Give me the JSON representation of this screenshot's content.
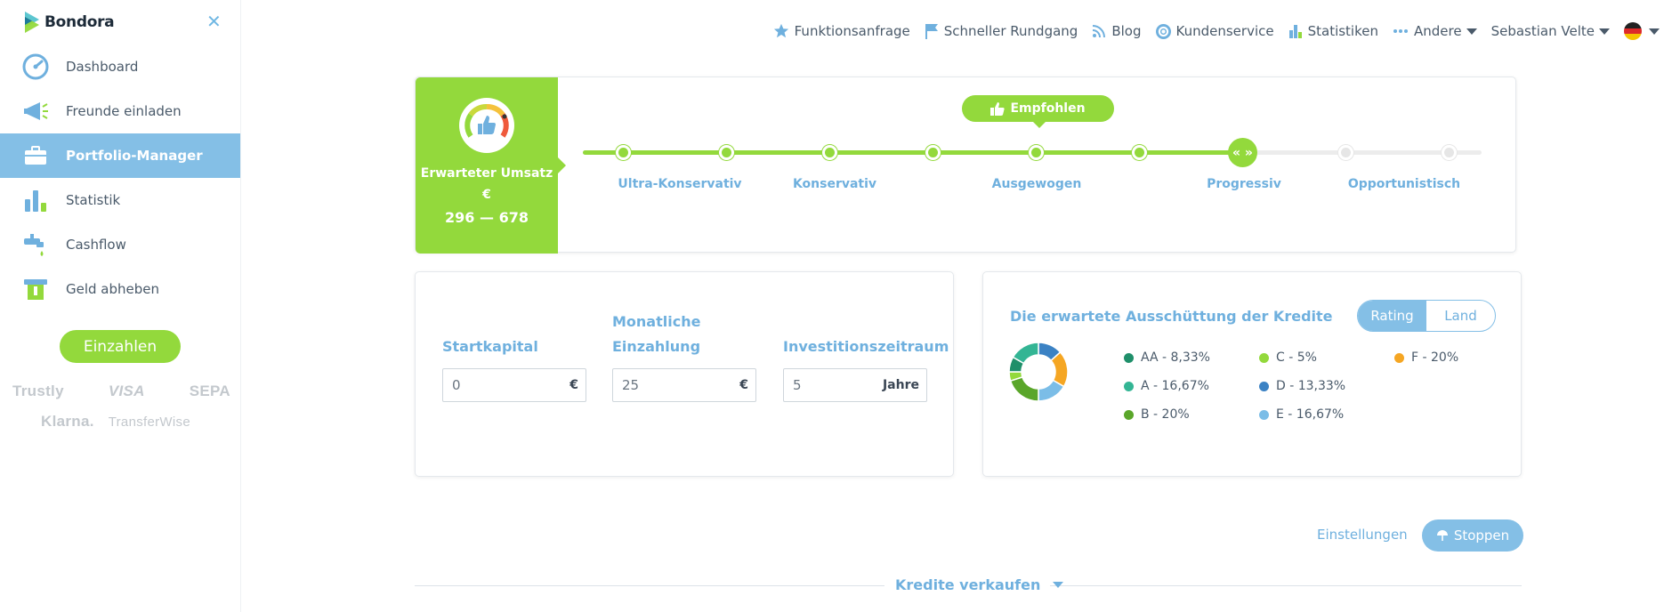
{
  "brand": {
    "name": "Bondora",
    "green": "#93d93c",
    "blue": "#84bfe6",
    "link": "#6fb0de"
  },
  "sidebar": {
    "close_icon": "close-icon",
    "items": [
      {
        "label": "Dashboard",
        "icon": "speedometer-icon",
        "active": false
      },
      {
        "label": "Freunde einladen",
        "icon": "megaphone-icon",
        "active": false
      },
      {
        "label": "Portfolio-Manager",
        "icon": "briefcase-icon",
        "active": true
      },
      {
        "label": "Statistik",
        "icon": "bar-chart-icon",
        "active": false
      },
      {
        "label": "Cashflow",
        "icon": "faucet-icon",
        "active": false
      },
      {
        "label": "Geld abheben",
        "icon": "withdraw-icon",
        "active": false
      }
    ],
    "deposit_label": "Einzahlen",
    "payment_logos": [
      "Trustly",
      "VISA",
      "SEPA",
      "Klarna.",
      "TransferWise"
    ]
  },
  "topbar": {
    "items": [
      {
        "label": "Funktionsanfrage",
        "icon": "star-icon"
      },
      {
        "label": "Schneller Rundgang",
        "icon": "flag-icon"
      },
      {
        "label": "Blog",
        "icon": "rss-icon"
      },
      {
        "label": "Kundenservice",
        "icon": "lifebuoy-icon"
      },
      {
        "label": "Statistiken",
        "icon": "bar-chart-icon"
      },
      {
        "label": "Andere",
        "icon": "more-dots-icon"
      },
      {
        "label": "Sebastian Velte",
        "icon": ""
      }
    ],
    "language_flag": "german-flag-icon"
  },
  "strategy": {
    "panel": {
      "title": "Erwarteter Umsatz",
      "currency": "€",
      "range": "296 — 678"
    },
    "recommended_label": "Empfohlen",
    "current_marker": "« »",
    "steps_total": 9,
    "current_step": 7,
    "recommended_step": 5,
    "labels": [
      "Ultra-Konservativ",
      "Konservativ",
      "Ausgewogen",
      "Progressiv",
      "Opportunistisch"
    ]
  },
  "inputs": {
    "start": {
      "label": "Startkapital",
      "value": "0",
      "unit": "€"
    },
    "monthly": {
      "label": "Monatliche Einzahlung",
      "value": "25",
      "unit": "€"
    },
    "period": {
      "label": "Investitionszeitraum",
      "value": "5",
      "unit": "Jahre"
    }
  },
  "distribution": {
    "title": "Die erwartete Ausschüttung der Kredite",
    "toggle": [
      "Rating",
      "Land"
    ],
    "active_toggle": "Rating",
    "slices": [
      {
        "label": "AA - 8,33%",
        "value": 8.33,
        "color": "#1f8f6a"
      },
      {
        "label": "A - 16,67%",
        "value": 16.67,
        "color": "#33b594"
      },
      {
        "label": "B - 20%",
        "value": 20,
        "color": "#5aa62a"
      },
      {
        "label": "C - 5%",
        "value": 5,
        "color": "#93d93c"
      },
      {
        "label": "D - 13,33%",
        "value": 13.33,
        "color": "#3b82c4"
      },
      {
        "label": "E - 16,67%",
        "value": 16.67,
        "color": "#7bbde7"
      },
      {
        "label": "F - 20%",
        "value": 20,
        "color": "#f5a623"
      }
    ]
  },
  "actions": {
    "settings": "Einstellungen",
    "stop": "Stoppen",
    "sell": "Kredite verkaufen"
  }
}
